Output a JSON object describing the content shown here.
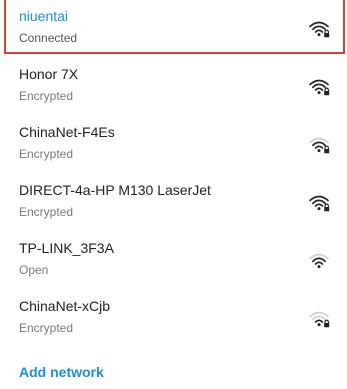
{
  "networks": [
    {
      "name": "niuentai",
      "status": "Connected",
      "signal": 4,
      "locked": true,
      "selected": true,
      "icon": "wifi-lock-icon"
    },
    {
      "name": "Honor 7X",
      "status": "Encrypted",
      "signal": 4,
      "locked": true,
      "icon": "wifi-lock-icon"
    },
    {
      "name": "ChinaNet-F4Es",
      "status": "Encrypted",
      "signal": 3,
      "locked": true,
      "icon": "wifi-lock-icon"
    },
    {
      "name": "DIRECT-4a-HP M130 LaserJet",
      "status": "Encrypted",
      "signal": 4,
      "locked": true,
      "icon": "wifi-lock-icon"
    },
    {
      "name": "TP-LINK_3F3A",
      "status": "Open",
      "signal": 3,
      "locked": false,
      "icon": "wifi-icon"
    },
    {
      "name": "ChinaNet-xCjb",
      "status": "Encrypted",
      "signal": 2,
      "locked": true,
      "icon": "wifi-lock-icon"
    }
  ],
  "add_network_label": "Add network",
  "colors": {
    "accent": "#1a8fd6",
    "highlight_border": "#e23b3b",
    "icon_dark": "#222222",
    "icon_dim": "#cfcfcf"
  }
}
